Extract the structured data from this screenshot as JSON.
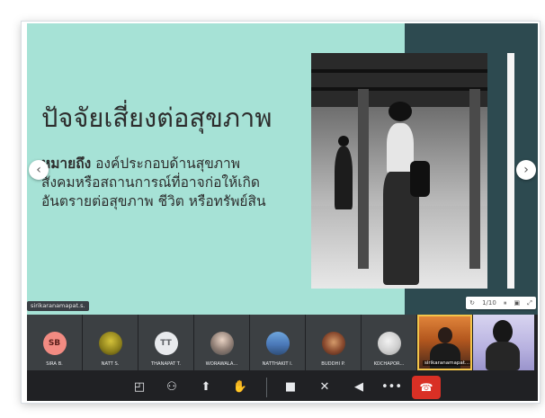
{
  "slide": {
    "title": "ปัจจัยเสี่ยงต่อสุขภาพ",
    "definition_lead": "หมายถึง",
    "definition_line1_rest": " องค์ประกอบด้านสุขภาพ",
    "definition_line2": "สังคมหรือสถานการณ์ที่อาจก่อให้เกิด",
    "definition_line3": "อันตรายต่อสุขภาพ ชีวิต หรือทรัพย์สิน",
    "prev_icon": "chevron-left-icon",
    "next_icon": "chevron-right-icon",
    "prev_glyph": "‹",
    "next_glyph": "›"
  },
  "presenter_tag": "sirikaranamapat.s.",
  "slide_controls": {
    "counter": "1/10",
    "icons": [
      "refresh-icon",
      "pause-icon",
      "layout-icon",
      "fullscreen-icon"
    ]
  },
  "participants": [
    {
      "initials": "SB",
      "name": "SIRA B.",
      "color": "#f28b82",
      "text_color": "#5b1f1a"
    },
    {
      "initials": "",
      "name": "NATT S.",
      "color": "#c9a227",
      "text_color": "#ffffff",
      "icon": "shrek-avatar"
    },
    {
      "initials": "TT",
      "name": "THANAPAT T.",
      "color": "#e8eaed",
      "text_color": "#5f6368"
    },
    {
      "initials": "",
      "name": "WORAWALA...",
      "color": "#b0b6bd",
      "text_color": "#ffffff",
      "icon": "person-photo-avatar"
    },
    {
      "initials": "",
      "name": "NATTHAKIT I.",
      "color": "#7fb3e8",
      "text_color": "#ffffff",
      "icon": "landscape-photo-avatar"
    },
    {
      "initials": "",
      "name": "BUDDHI P.",
      "color": "#9b5a46",
      "text_color": "#ffffff",
      "icon": "group-photo-avatar"
    },
    {
      "initials": "",
      "name": "KOCHAPOR...",
      "color": "#d7d7d7",
      "text_color": "#ffffff",
      "icon": "circle-photo-avatar"
    }
  ],
  "video_tiles": [
    {
      "name": "sirikaranamapat..."
    },
    {
      "name": ""
    }
  ],
  "controls": {
    "items": [
      {
        "name": "chat-icon",
        "glyph": "◰"
      },
      {
        "name": "people-icon",
        "glyph": "⚇"
      },
      {
        "name": "present-screen-icon",
        "glyph": "⬆"
      },
      {
        "name": "raise-hand-icon",
        "glyph": "✋"
      },
      {
        "name": "camera-icon",
        "glyph": "■"
      },
      {
        "name": "mic-off-icon",
        "glyph": "✕"
      },
      {
        "name": "speaker-icon",
        "glyph": "◀"
      },
      {
        "name": "more-options-icon",
        "glyph": "•••"
      }
    ],
    "end_call_glyph": "☎"
  },
  "colors": {
    "slide_mint": "#a6e2d6",
    "slide_dark": "#2d4a50",
    "meeting_bg": "#202124",
    "end_call": "#d93025"
  }
}
